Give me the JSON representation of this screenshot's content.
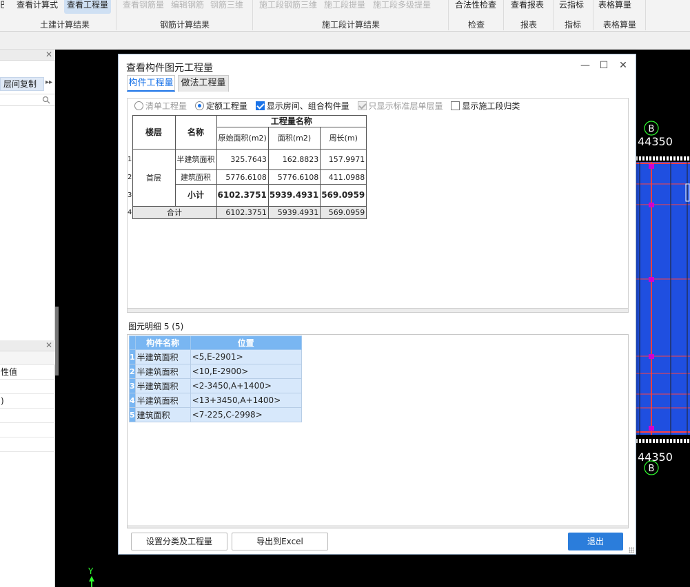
{
  "ribbon": {
    "buttons": [
      {
        "label": "查看计算式",
        "state": "normal"
      },
      {
        "label": "查看工程量",
        "state": "active"
      },
      {
        "label": "查看钢筋量",
        "state": "dim"
      },
      {
        "label": "编辑钢筋",
        "state": "dim"
      },
      {
        "label": "钢筋三维",
        "state": "dim"
      },
      {
        "label": "施工段钢筋三维",
        "state": "dim"
      },
      {
        "label": "施工段提量",
        "state": "dim"
      },
      {
        "label": "施工段多级提量",
        "state": "dim"
      },
      {
        "label": "合法性检查",
        "state": "normal"
      },
      {
        "label": "查看报表",
        "state": "normal"
      },
      {
        "label": "云指标",
        "state": "normal"
      },
      {
        "label": "表格算量",
        "state": "normal"
      }
    ],
    "groups": [
      "土建计算结果",
      "钢筋计算结果",
      "施工段计算结果",
      "检查",
      "报表",
      "指标",
      "表格算量"
    ]
  },
  "left_panel": {
    "layer_copy": "层间复制",
    "more": "▸▸",
    "rows": [
      "性值",
      "",
      ")",
      "",
      "",
      ""
    ]
  },
  "canvas": {
    "axis_label_top": "B",
    "axis_label_bottom": "B",
    "dim_text_top": "44350",
    "dim_text_bottom": "44350",
    "y_axis": "Y"
  },
  "dialog": {
    "title": "查看构件图元工程量",
    "controls": {
      "minimize": "—",
      "maximize": "☐",
      "close": "✕"
    },
    "tabs": [
      "构件工程量",
      "做法工程量"
    ],
    "options": [
      {
        "label": "清单工程量",
        "type": "radio",
        "checked": false,
        "disabled": true
      },
      {
        "label": "定额工程量",
        "type": "radio",
        "checked": true,
        "disabled": false
      },
      {
        "label": "显示房间、组合构件量",
        "type": "checkbox",
        "checked": true,
        "disabled": false
      },
      {
        "label": "只显示标准层单层量",
        "type": "checkbox",
        "checked": true,
        "disabled": true
      },
      {
        "label": "显示施工段归类",
        "type": "checkbox",
        "checked": false,
        "disabled": false
      }
    ],
    "qty_table": {
      "header_floor": "楼层",
      "header_name": "名称",
      "header_group": "工程量名称",
      "header_cols": [
        "原始面积(m2)",
        "面积(m2)",
        "周长(m)"
      ],
      "floor": "首层",
      "rows": [
        {
          "no": "1",
          "name": "半建筑面积",
          "values": [
            "325.7643",
            "162.8823",
            "157.9971"
          ]
        },
        {
          "no": "2",
          "name": "建筑面积",
          "values": [
            "5776.6108",
            "5776.6108",
            "411.0988"
          ]
        },
        {
          "no": "3",
          "name": "小计",
          "values": [
            "6102.3751",
            "5939.4931",
            "569.0959"
          ]
        }
      ],
      "total": {
        "no": "4",
        "name": "合计",
        "values": [
          "6102.3751",
          "5939.4931",
          "569.0959"
        ]
      }
    },
    "detail_label": "图元明细  5 (5)",
    "elem_table": {
      "headers": [
        "构件名称",
        "位置"
      ],
      "rows": [
        {
          "no": "1",
          "name": "半建筑面积",
          "pos": "<5,E-2901>"
        },
        {
          "no": "2",
          "name": "半建筑面积",
          "pos": "<10,E-2900>"
        },
        {
          "no": "3",
          "name": "半建筑面积",
          "pos": "<2-3450,A+1400>"
        },
        {
          "no": "4",
          "name": "半建筑面积",
          "pos": "<13+3450,A+1400>"
        },
        {
          "no": "5",
          "name": "建筑面积",
          "pos": "<7-225,C-2998>"
        }
      ]
    },
    "buttons": {
      "settings": "设置分类及工程量",
      "export": "导出到Excel",
      "exit": "退出"
    }
  }
}
